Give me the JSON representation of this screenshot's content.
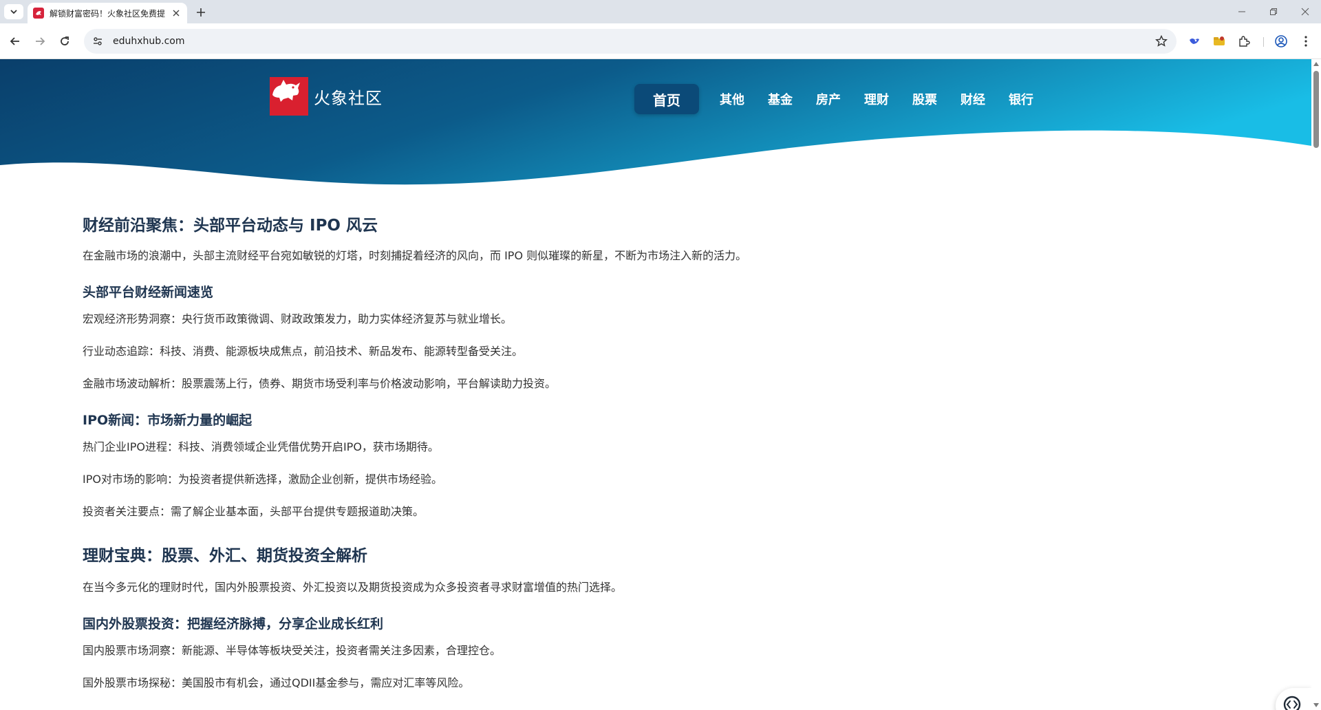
{
  "browser": {
    "tab_title": "解锁财富密码！火象社区免费提",
    "url": "eduhxhub.com"
  },
  "site": {
    "logo_text": "火象社区",
    "nav_home": "首页",
    "nav_items": [
      "其他",
      "基金",
      "房产",
      "理财",
      "股票",
      "财经",
      "银行"
    ]
  },
  "article": {
    "s1_title": "财经前沿聚焦：头部平台动态与 IPO 风云",
    "s1_intro": "在金融市场的浪潮中，头部主流财经平台宛如敏锐的灯塔，时刻捕捉着经济的风向，而 IPO 则似璀璨的新星，不断为市场注入新的活力。",
    "s1_sub1": "头部平台财经新闻速览",
    "s1_sub1_items": [
      "宏观经济形势洞察：央行货币政策微调、财政政策发力，助力实体经济复苏与就业增长。",
      "行业动态追踪：科技、消费、能源板块成焦点，前沿技术、新品发布、能源转型备受关注。",
      "金融市场波动解析：股票震荡上行，债券、期货市场受利率与价格波动影响，平台解读助力投资。"
    ],
    "s1_sub2": "IPO新闻：市场新力量的崛起",
    "s1_sub2_items": [
      "热门企业IPO进程：科技、消费领域企业凭借优势开启IPO，获市场期待。",
      "IPO对市场的影响：为投资者提供新选择，激励企业创新，提供市场经验。",
      "投资者关注要点：需了解企业基本面，头部平台提供专题报道助决策。"
    ],
    "s2_title": "理财宝典：股票、外汇、期货投资全解析",
    "s2_intro": "在当今多元化的理财时代，国内外股票投资、外汇投资以及期货投资成为众多投资者寻求财富增值的热门选择。",
    "s2_sub1": "国内外股票投资：把握经济脉搏，分享企业成长红利",
    "s2_sub1_items": [
      "国内股票市场洞察：新能源、半导体等板块受关注，投资者需关注多因素，合理控仓。",
      "国外股票市场探秘：美国股市有机会，通过QDII基金参与，需应对汇率等风险。"
    ]
  },
  "icons": {
    "tab_menu": "chevron-down-icon",
    "favicon": "site-favicon-icon",
    "tab_close": "close-icon",
    "new_tab": "plus-icon",
    "back": "arrow-left-icon",
    "forward": "arrow-right-icon",
    "reload": "reload-icon",
    "site_info": "tune-icon",
    "bookmark": "star-icon",
    "extensions": "puzzle-icon",
    "profile": "profile-icon",
    "menu": "kebab-menu-icon",
    "float": "code-search-icon"
  },
  "colors": {
    "hero_dark": "#0a3f6b",
    "hero_light": "#19bde6",
    "logo_red": "#d9202f",
    "heading": "#1f3550"
  }
}
